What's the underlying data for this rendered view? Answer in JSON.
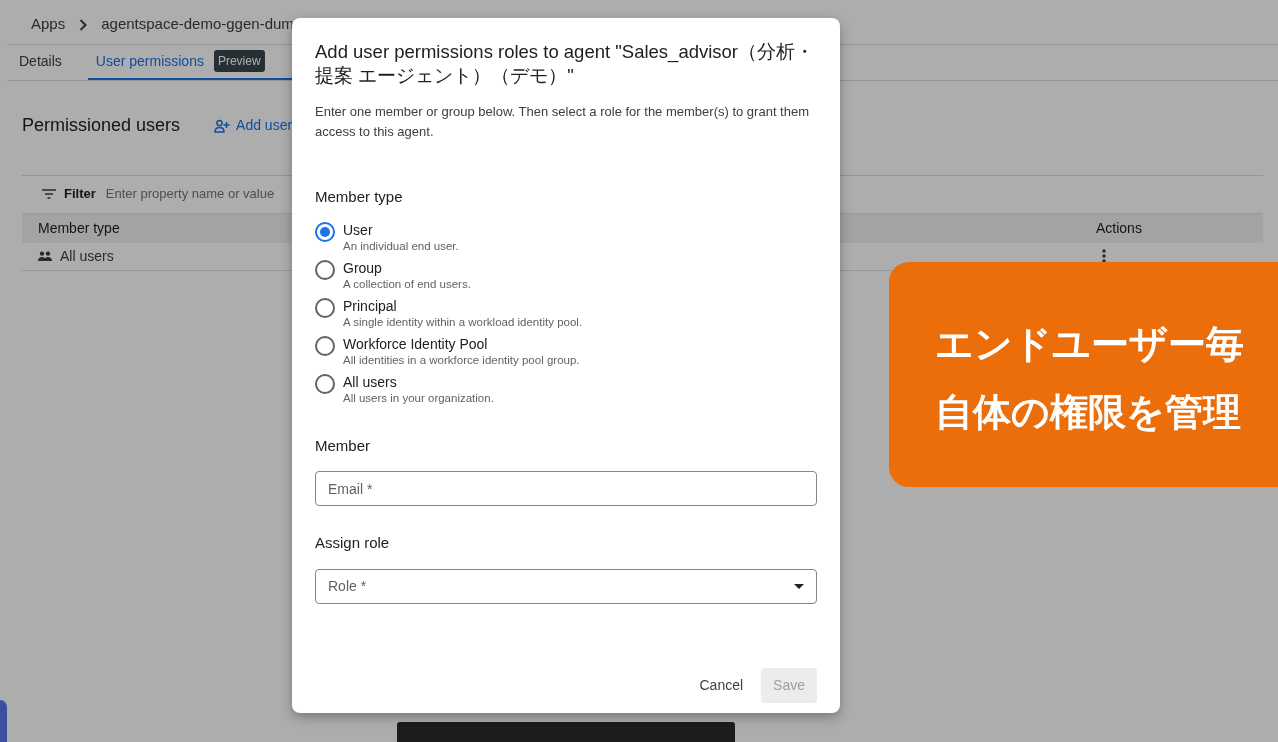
{
  "breadcrumb": [
    "Apps",
    "agentspace-demo-ggen-dum"
  ],
  "tabs": [
    {
      "label": "Details",
      "selected": false
    },
    {
      "label": "User permissions",
      "selected": true,
      "badge": "Preview"
    }
  ],
  "section": {
    "title": "Permissioned users",
    "add_button": "Add user"
  },
  "filter": {
    "label": "Filter",
    "placeholder": "Enter property name or value"
  },
  "table": {
    "columns": [
      "Member type",
      "Actions"
    ],
    "rows": [
      {
        "member_type": "All users"
      }
    ]
  },
  "dialog": {
    "title": "Add user permissions roles to agent \"Sales_advisor（分析・提案 エージェント）（デモ）\"",
    "description": "Enter one member or group below. Then select a role for the member(s) to grant them access to this agent.",
    "member_type_label": "Member type",
    "options": [
      {
        "label": "User",
        "description": "An individual end user.",
        "selected": true
      },
      {
        "label": "Group",
        "description": "A collection of end users.",
        "selected": false
      },
      {
        "label": "Principal",
        "description": "A single identity within a workload identity pool.",
        "selected": false
      },
      {
        "label": "Workforce Identity Pool",
        "description": "All identities in a workforce identity pool group.",
        "selected": false
      },
      {
        "label": "All users",
        "description": "All users in your organization.",
        "selected": false
      }
    ],
    "member_label": "Member",
    "email": {
      "placeholder": "Email *"
    },
    "role_label": "Assign role",
    "role": {
      "placeholder": "Role *"
    },
    "buttons": [
      {
        "label": "Cancel",
        "disabled": false
      },
      {
        "label": "Save",
        "disabled": true
      }
    ]
  },
  "callout": {
    "lines": [
      "エンドユーザー毎",
      "自体の権限を管理"
    ]
  }
}
